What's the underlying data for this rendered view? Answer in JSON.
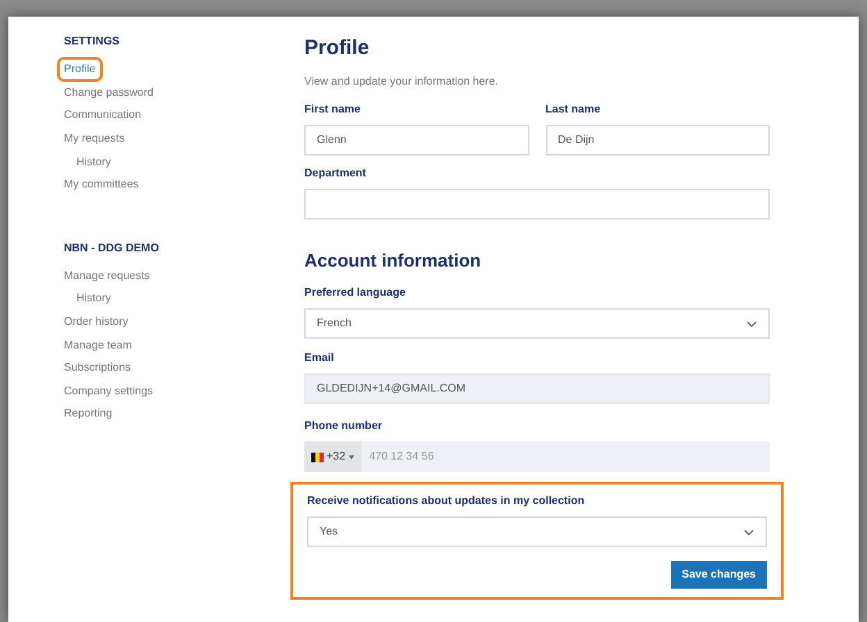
{
  "sidebar": {
    "sections": [
      {
        "title": "SETTINGS",
        "items": [
          {
            "label": "Profile",
            "selected": true,
            "highlighted": true
          },
          {
            "label": "Change password",
            "selected": false,
            "highlighted": false
          },
          {
            "label": "Communication",
            "selected": false,
            "highlighted": false
          },
          {
            "label": "My requests",
            "selected": false,
            "highlighted": false,
            "children": [
              {
                "label": "History",
                "selected": false,
                "highlighted": false
              }
            ]
          },
          {
            "label": "My committees",
            "selected": false,
            "highlighted": false
          }
        ]
      },
      {
        "title": "NBN - DDG DEMO",
        "items": [
          {
            "label": "Manage requests",
            "selected": false,
            "highlighted": false,
            "children": [
              {
                "label": "History",
                "selected": false,
                "highlighted": false
              }
            ]
          },
          {
            "label": "Order history",
            "selected": false,
            "highlighted": false
          },
          {
            "label": "Manage team",
            "selected": false,
            "highlighted": false
          },
          {
            "label": "Subscriptions",
            "selected": false,
            "highlighted": false
          },
          {
            "label": "Company settings",
            "selected": false,
            "highlighted": false
          },
          {
            "label": "Reporting",
            "selected": false,
            "highlighted": false
          }
        ]
      }
    ]
  },
  "profile": {
    "title": "Profile",
    "subtitle": "View and update your information here.",
    "first_name": {
      "label": "First name",
      "value": "Glenn"
    },
    "last_name": {
      "label": "Last name",
      "value": "De Dijn"
    },
    "department": {
      "label": "Department"
    }
  },
  "account": {
    "title": "Account information",
    "language": {
      "label": "Preferred language",
      "value": "French"
    },
    "email": {
      "label": "Email",
      "value": "GLDEDIJN+14@GMAIL.COM",
      "disabled": true
    },
    "phone": {
      "label": "Phone number",
      "country_code": "+32",
      "placeholder": "470 12 34 56"
    },
    "notifications": {
      "label": "Receive notifications about updates in my collection",
      "value": "Yes",
      "highlighted": true
    },
    "save_button": "Save changes"
  }
}
